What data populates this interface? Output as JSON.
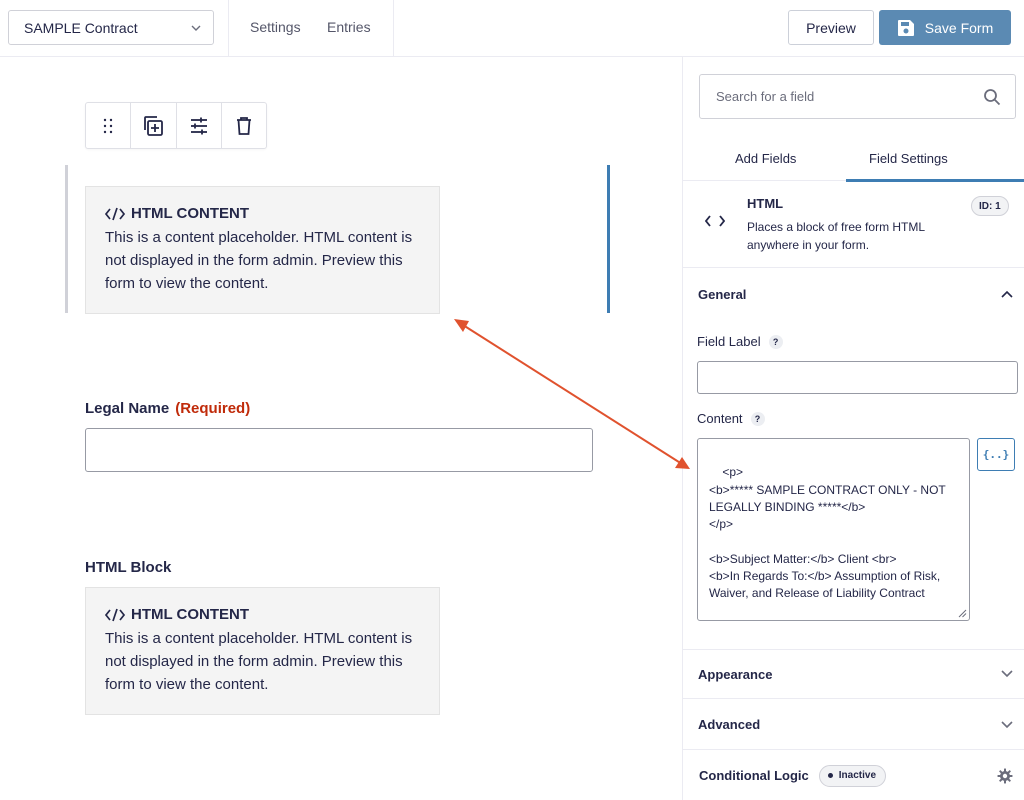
{
  "header": {
    "form_name": "SAMPLE Contract",
    "nav": [
      "Settings",
      "Entries"
    ],
    "preview_label": "Preview",
    "save_label": "Save Form"
  },
  "canvas": {
    "html_blocks": [
      {
        "title": "HTML CONTENT",
        "text": "This is a content placeholder. HTML content is not displayed in the form admin. Preview this form to view the content."
      },
      {
        "label": "HTML Block",
        "title": "HTML CONTENT",
        "text": "This is a content placeholder. HTML content is not displayed in the form admin. Preview this form to view the content."
      }
    ],
    "legal_name": {
      "label": "Legal Name",
      "required": "(Required)"
    }
  },
  "sidebar": {
    "search_placeholder": "Search for a field",
    "tabs": [
      "Add Fields",
      "Field Settings"
    ],
    "active_tab": "Field Settings",
    "field": {
      "name": "HTML",
      "description": "Places a block of free form HTML anywhere in your form.",
      "id_badge": "ID: 1"
    },
    "sections": {
      "general": "General",
      "appearance": "Appearance",
      "advanced": "Advanced",
      "conditional_logic": "Conditional Logic"
    },
    "field_label": "Field Label",
    "content_label": "Content",
    "content_value": "<p>\n<b>***** SAMPLE CONTRACT ONLY - NOT LEGALLY BINDING *****</b>\n</p>\n\n<b>Subject Matter:</b> Client <br>\n<b>In Regards To:</b> Assumption of Risk, Waiver, and Release of Liability Contract",
    "merge_tag_glyph": "{..}",
    "help_glyph": "?",
    "conditional_status": "Inactive"
  },
  "colors": {
    "accent": "#3e7db3",
    "save_button": "#5b8ab3",
    "required": "#c02b0a",
    "arrow": "#e0522e"
  }
}
